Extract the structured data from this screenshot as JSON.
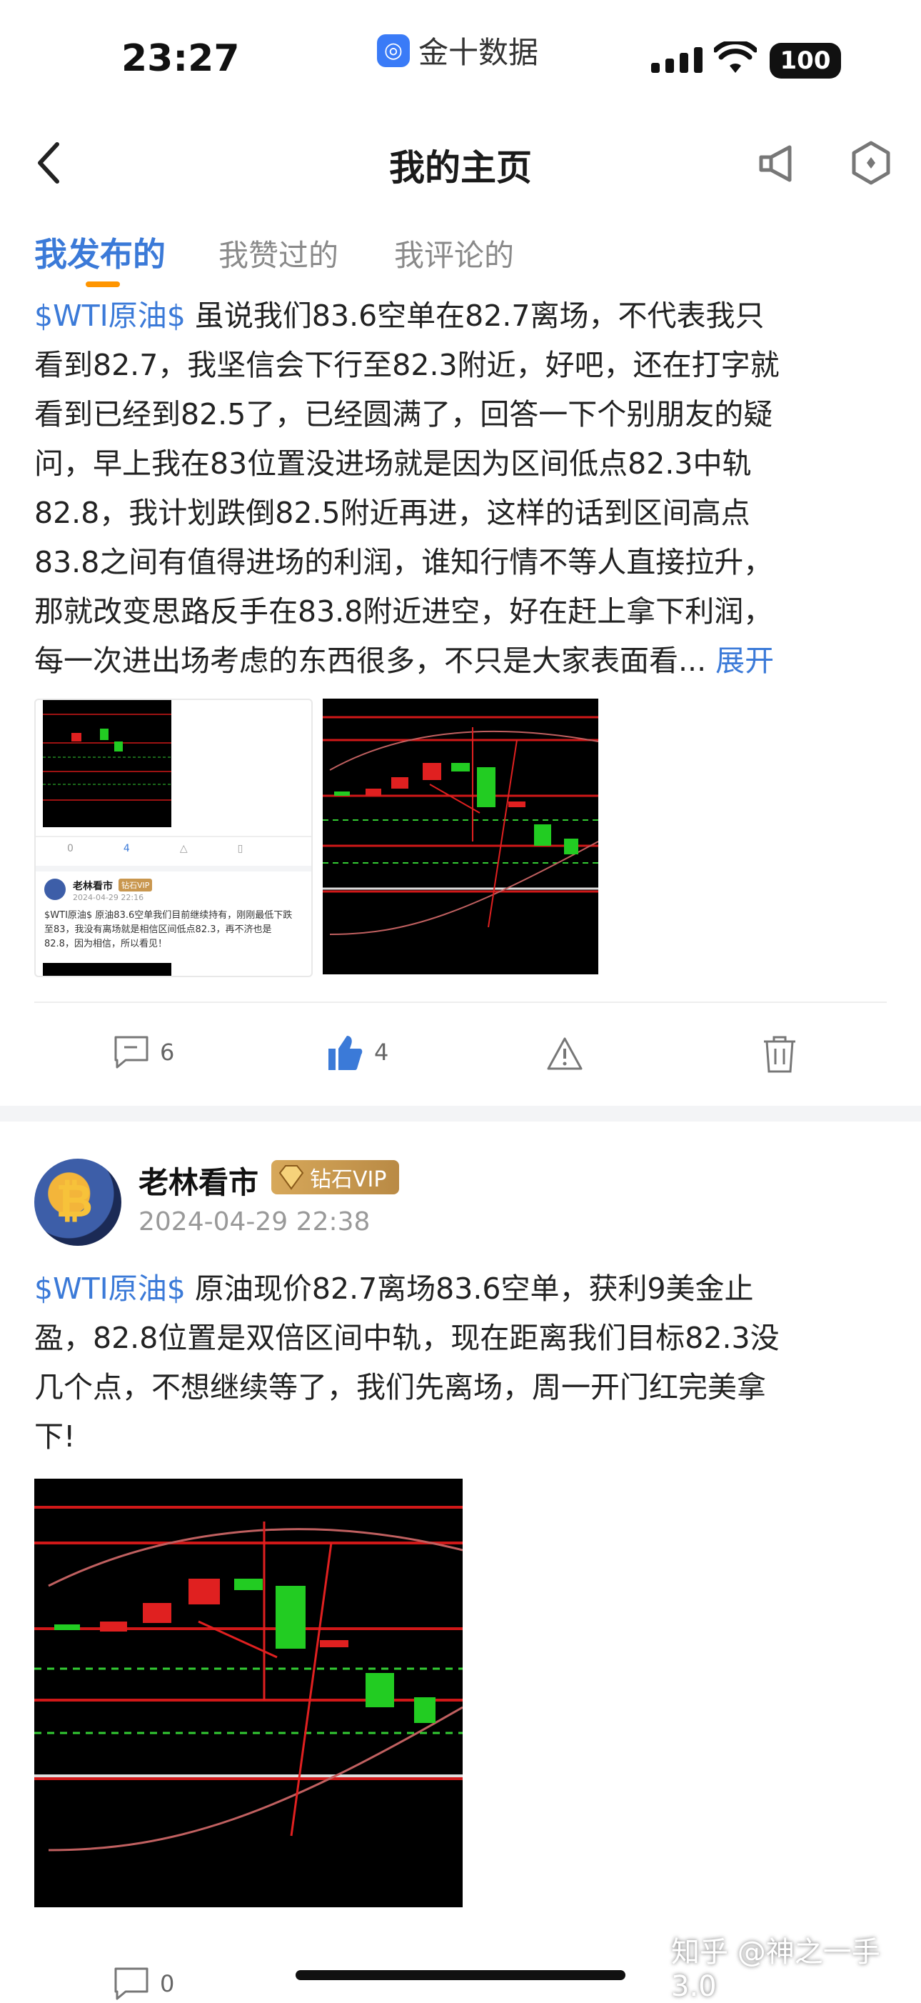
{
  "status": {
    "time": "23:27",
    "app_name": "金十数据",
    "battery": "100"
  },
  "nav": {
    "title": "我的主页"
  },
  "tabs": [
    {
      "label": "我发布的",
      "active": true
    },
    {
      "label": "我赞过的",
      "active": false
    },
    {
      "label": "我评论的",
      "active": false
    }
  ],
  "post1": {
    "lines": [
      "$WTI原油$  虽说我们83.6空单在82.7离场，不代表我只",
      "看到82.7，我坚信会下行至82.3附近，好吧，还在打字就",
      "看到已经到82.5了，已经圆满了，回答一下个别朋友的疑",
      "问，早上我在83位置没进场就是因为区间低点82.3中轨",
      "82.8，我计划跌倒82.5附近再进，这样的话到区间高点",
      "83.8之间有值得进场的利润，谁知行情不等人直接拉升，",
      "那就改变思路反手在83.8附近进空，好在赶上拿下利润，",
      "每一次进出场考虑的东西很多，不只是大家表面看..."
    ],
    "expand": "展开",
    "embedded": {
      "author": "老林看市",
      "badge": "钻石VIP",
      "date": "2024-04-29 22:16",
      "text": "$WTI原油$ 原油83.6空单我们目前继续持有，刚刚最低下跌至83，我没有离场就是相信区间低点82.3，再不济也是82.8，因为相信，所以看见！",
      "comments": "0",
      "likes": "4"
    },
    "comments": "6",
    "likes": "4"
  },
  "post2": {
    "author": "老林看市",
    "badge": "钻石VIP",
    "date": "2024-04-29 22:38",
    "lines": [
      "$WTI原油$  原油现价82.7离场83.6空单，获利9美金止",
      "盈，82.8位置是双倍区间中轨，现在距离我们目标82.3没",
      "几个点，不想继续等了，我们先离场，周一开门红完美拿",
      "下!"
    ],
    "comments": "0"
  },
  "watermark": "知乎 @神之一手3.0",
  "colors": {
    "accent": "#3b7ad8",
    "tab_indicator": "#ff9500",
    "vip": "#c9974f"
  }
}
